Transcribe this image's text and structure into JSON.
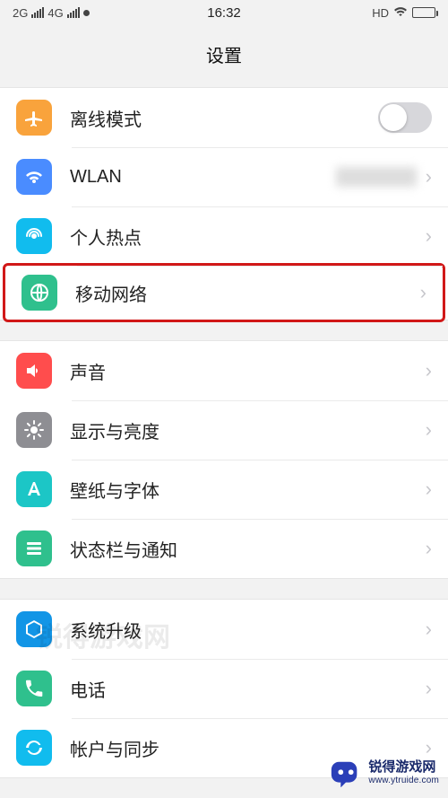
{
  "status": {
    "net_2g": "2G",
    "net_4g": "4G",
    "time": "16:32",
    "hd": "HD"
  },
  "header": {
    "title": "设置"
  },
  "groups": [
    {
      "rows": [
        {
          "key": "airplane",
          "label": "离线模式",
          "icon": "airplane-icon",
          "color": "#f9a33c",
          "control": "toggle",
          "toggle": false
        },
        {
          "key": "wlan",
          "label": "WLAN",
          "icon": "wifi-icon",
          "color": "#4a8cff",
          "control": "disclosure",
          "value_hidden": true
        },
        {
          "key": "hotspot",
          "label": "个人热点",
          "icon": "hotspot-icon",
          "color": "#11bcee",
          "control": "disclosure"
        },
        {
          "key": "mobile",
          "label": "移动网络",
          "icon": "globe-icon",
          "color": "#2fc08d",
          "control": "disclosure",
          "highlighted": true
        }
      ]
    },
    {
      "rows": [
        {
          "key": "sound",
          "label": "声音",
          "icon": "speaker-icon",
          "color": "#ff4d4d",
          "control": "disclosure"
        },
        {
          "key": "display",
          "label": "显示与亮度",
          "icon": "brightness-icon",
          "color": "#8e8e93",
          "control": "disclosure"
        },
        {
          "key": "wallpaper",
          "label": "壁纸与字体",
          "icon": "font-icon",
          "color": "#1cc6c6",
          "control": "disclosure"
        },
        {
          "key": "statusbar",
          "label": "状态栏与通知",
          "icon": "list-icon",
          "color": "#2fc08d",
          "control": "disclosure"
        }
      ]
    },
    {
      "rows": [
        {
          "key": "update",
          "label": "系统升级",
          "icon": "cube-icon",
          "color": "#1295e6",
          "control": "disclosure"
        },
        {
          "key": "phone",
          "label": "电话",
          "icon": "phone-icon",
          "color": "#2fc08d",
          "control": "disclosure"
        },
        {
          "key": "account",
          "label": "帐户与同步",
          "icon": "sync-icon",
          "color": "#11bcee",
          "control": "disclosure"
        }
      ]
    }
  ],
  "watermark": {
    "center": "锐得游戏网",
    "corner_title": "锐得游戏网",
    "corner_url": "www.ytruide.com"
  }
}
